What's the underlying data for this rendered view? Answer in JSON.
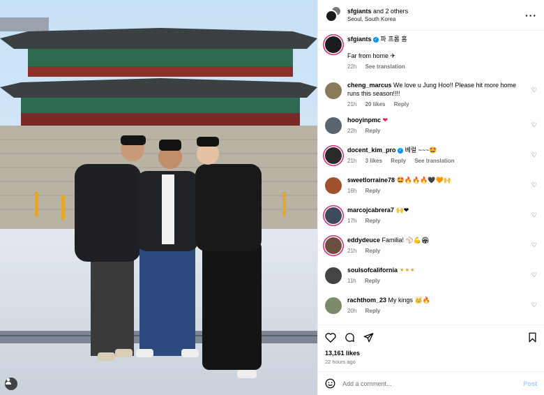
{
  "header": {
    "account": "sfgiants",
    "and_others": "and 2 others",
    "location": "Seoul, South Korea"
  },
  "caption": {
    "user": "sfgiants",
    "tagline": "파 프롬 홈",
    "text": "Far from home ✈",
    "time": "22h",
    "see_translation": "See translation"
  },
  "comments": [
    {
      "user": "cheng_marcus",
      "text": "We love u Jung Hoo!! Please hit more home runs this season!!!!",
      "time": "21h",
      "likes": "20 likes",
      "reply": "Reply",
      "avatar_color": "#8a7a5a"
    },
    {
      "user": "hooyinpmc",
      "text": "❤",
      "time": "22h",
      "reply": "Reply",
      "avatar_color": "#5a6570"
    },
    {
      "user": "docent_kim_pro",
      "text": "베럴 ~~~🤩",
      "time": "21h",
      "likes": "3 likes",
      "reply": "Reply",
      "see_translation": "See translation",
      "avatar_color": "#2a2a2a"
    },
    {
      "user": "sweetlorraine78",
      "text": "🤩🔥🔥🔥🖤🧡🙌",
      "time": "16h",
      "reply": "Reply",
      "avatar_color": "#a0522d"
    },
    {
      "user": "marcojcabrera7",
      "text": "🙌❤",
      "time": "17h",
      "reply": "Reply",
      "avatar_color": "#3d4a5c"
    },
    {
      "user": "eddydeuce",
      "text": "Familia! ⚾💪🏟",
      "time": "21h",
      "reply": "Reply",
      "avatar_color": "#6b4e3d"
    },
    {
      "user": "soulsofcalifornia",
      "text": "✴✴✴",
      "time": "11h",
      "reply": "Reply",
      "avatar_color": "#444"
    },
    {
      "user": "rachthom_23",
      "text": "My kings 👑🔥",
      "time": "20h",
      "reply": "Reply",
      "avatar_color": "#7a8a6a"
    }
  ],
  "likes": "13,161 likes",
  "posted_ago": "22 hours ago",
  "add_comment": {
    "placeholder": "Add a comment...",
    "post_label": "Post"
  },
  "colors": {
    "giants_orange": "#fd5a1e",
    "verified_blue": "#0095f6",
    "link_blue": "#0095f6"
  }
}
